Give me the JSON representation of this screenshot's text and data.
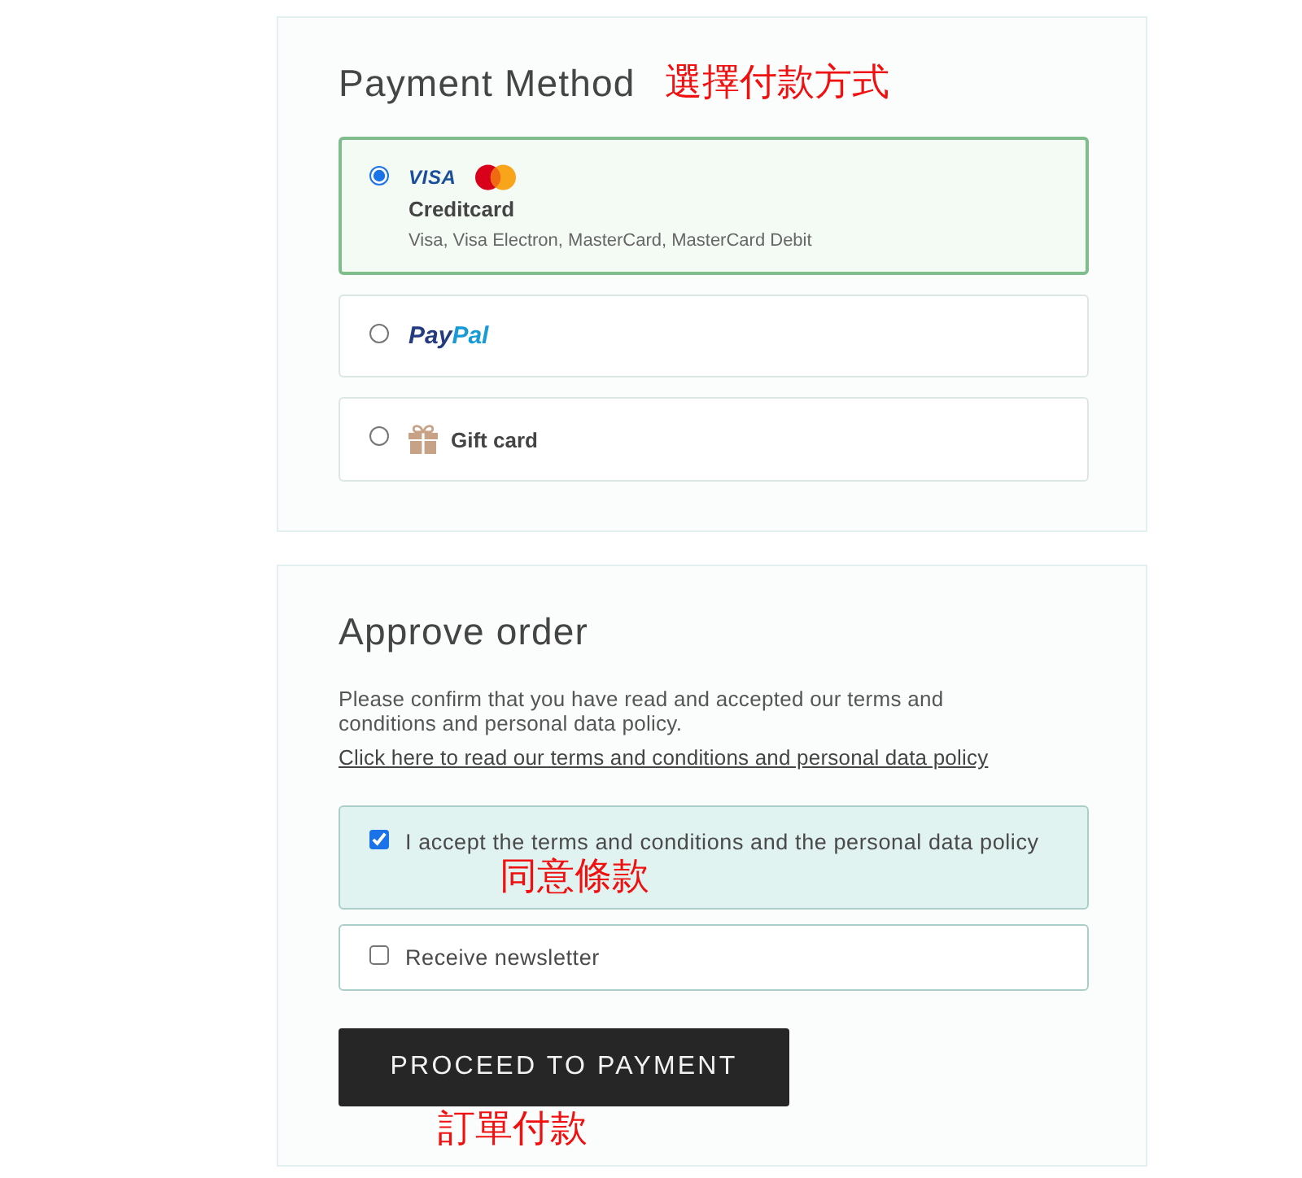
{
  "payment_method": {
    "title": "Payment Method",
    "annotation": "選擇付款方式",
    "options": [
      {
        "kind": "card",
        "selected": true,
        "logos": [
          {
            "kind": "visa",
            "text": "VISA"
          },
          {
            "kind": "mastercard"
          }
        ],
        "label": "Creditcard",
        "description": "Visa, Visa Electron, MasterCard, MasterCard Debit"
      },
      {
        "kind": "paypal",
        "selected": false,
        "logo": [
          "Pay",
          "Pal"
        ]
      },
      {
        "kind": "gift",
        "selected": false,
        "label": "Gift card"
      }
    ]
  },
  "approve_order": {
    "title": "Approve order",
    "text": "Please confirm that you have read and accepted our terms and conditions and personal data policy.",
    "link": "Click here to read our terms and conditions and personal data policy",
    "checkboxes": [
      {
        "label": "I accept the terms and conditions and the personal data policy",
        "checked": true,
        "annotation": "同意條款"
      },
      {
        "label": "Receive newsletter",
        "checked": false
      }
    ],
    "button": {
      "label": "PROCEED TO PAYMENT",
      "annotation": "訂單付款"
    }
  }
}
